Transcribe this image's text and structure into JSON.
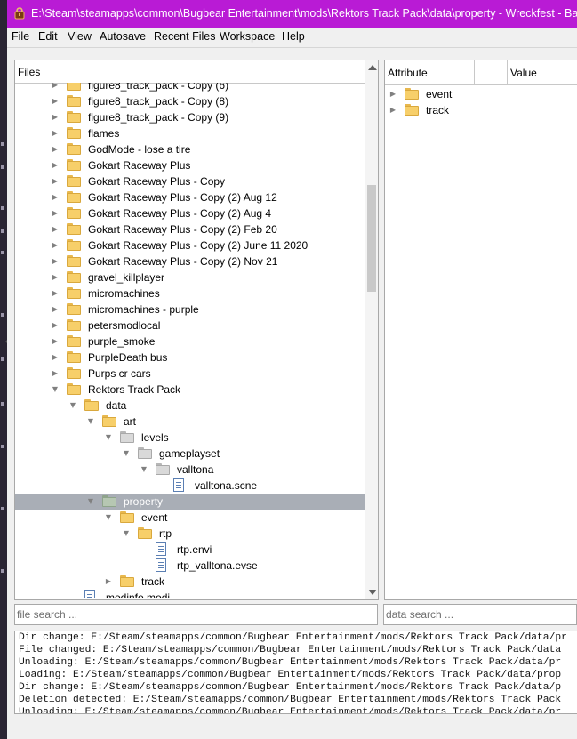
{
  "window": {
    "title": "E:\\Steam\\steamapps\\common\\Bugbear Entertainment\\mods\\Rektors Track Pack\\data\\property - Wreckfest - Bag Ed"
  },
  "menu": [
    "File",
    "Edit",
    "View",
    "Autosave",
    "Recent Files",
    "Workspace",
    "Help"
  ],
  "files_panel": {
    "header": "Files",
    "rows": [
      {
        "label": "figure8_track_pack - Copy (6)",
        "depth": 1,
        "type": "folder",
        "expander": "collapsed",
        "color": "yellow"
      },
      {
        "label": "figure8_track_pack - Copy (8)",
        "depth": 1,
        "type": "folder",
        "expander": "collapsed",
        "color": "yellow"
      },
      {
        "label": "figure8_track_pack - Copy (9)",
        "depth": 1,
        "type": "folder",
        "expander": "collapsed",
        "color": "yellow"
      },
      {
        "label": "flames",
        "depth": 1,
        "type": "folder",
        "expander": "collapsed",
        "color": "yellow"
      },
      {
        "label": "GodMode - lose a tire",
        "depth": 1,
        "type": "folder",
        "expander": "collapsed",
        "color": "yellow"
      },
      {
        "label": "Gokart Raceway Plus",
        "depth": 1,
        "type": "folder",
        "expander": "collapsed",
        "color": "yellow"
      },
      {
        "label": "Gokart Raceway Plus - Copy",
        "depth": 1,
        "type": "folder",
        "expander": "collapsed",
        "color": "yellow"
      },
      {
        "label": "Gokart Raceway Plus - Copy (2) Aug 12",
        "depth": 1,
        "type": "folder",
        "expander": "collapsed",
        "color": "yellow"
      },
      {
        "label": "Gokart Raceway Plus - Copy (2) Aug 4",
        "depth": 1,
        "type": "folder",
        "expander": "collapsed",
        "color": "yellow"
      },
      {
        "label": "Gokart Raceway Plus - Copy (2) Feb 20",
        "depth": 1,
        "type": "folder",
        "expander": "collapsed",
        "color": "yellow"
      },
      {
        "label": "Gokart Raceway Plus - Copy (2) June 11 2020",
        "depth": 1,
        "type": "folder",
        "expander": "collapsed",
        "color": "yellow"
      },
      {
        "label": "Gokart Raceway Plus - Copy (2) Nov 21",
        "depth": 1,
        "type": "folder",
        "expander": "collapsed",
        "color": "yellow"
      },
      {
        "label": "gravel_killplayer",
        "depth": 1,
        "type": "folder",
        "expander": "collapsed",
        "color": "yellow"
      },
      {
        "label": "micromachines",
        "depth": 1,
        "type": "folder",
        "expander": "collapsed",
        "color": "yellow"
      },
      {
        "label": "micromachines - purple",
        "depth": 1,
        "type": "folder",
        "expander": "collapsed",
        "color": "yellow"
      },
      {
        "label": "petersmodlocal",
        "depth": 1,
        "type": "folder",
        "expander": "collapsed",
        "color": "yellow"
      },
      {
        "label": "purple_smoke",
        "depth": 1,
        "type": "folder",
        "expander": "collapsed",
        "color": "yellow"
      },
      {
        "label": "PurpleDeath bus",
        "depth": 1,
        "type": "folder",
        "expander": "collapsed",
        "color": "yellow"
      },
      {
        "label": "Purps cr cars",
        "depth": 1,
        "type": "folder",
        "expander": "collapsed",
        "color": "yellow"
      },
      {
        "label": "Rektors Track Pack",
        "depth": 1,
        "type": "folder",
        "expander": "expanded",
        "color": "yellow"
      },
      {
        "label": "data",
        "depth": 2,
        "type": "folder",
        "expander": "expanded",
        "color": "yellow"
      },
      {
        "label": "art",
        "depth": 3,
        "type": "folder",
        "expander": "expanded",
        "color": "yellow"
      },
      {
        "label": "levels",
        "depth": 4,
        "type": "folder",
        "expander": "expanded",
        "color": "gray"
      },
      {
        "label": "gameplayset",
        "depth": 5,
        "type": "folder",
        "expander": "expanded",
        "color": "gray"
      },
      {
        "label": "valltona",
        "depth": 6,
        "type": "folder",
        "expander": "expanded",
        "color": "gray"
      },
      {
        "label": "valltona.scne",
        "depth": 7,
        "type": "file",
        "expander": "none"
      },
      {
        "label": "property",
        "depth": 3,
        "type": "folder",
        "expander": "expanded",
        "color": "green",
        "selected": true
      },
      {
        "label": "event",
        "depth": 4,
        "type": "folder",
        "expander": "expanded",
        "color": "yellow"
      },
      {
        "label": "rtp",
        "depth": 5,
        "type": "folder",
        "expander": "expanded",
        "color": "yellow"
      },
      {
        "label": "rtp.envi",
        "depth": 6,
        "type": "file",
        "expander": "none"
      },
      {
        "label": "rtp_valltona.evse",
        "depth": 6,
        "type": "file",
        "expander": "none"
      },
      {
        "label": "track",
        "depth": 4,
        "type": "folder",
        "expander": "collapsed",
        "color": "yellow"
      },
      {
        "label": "modinfo.modi",
        "depth": 2,
        "type": "file",
        "expander": "none"
      }
    ]
  },
  "attributes_panel": {
    "columns": [
      "Attribute",
      "",
      "Value"
    ],
    "rows": [
      {
        "label": "event",
        "expander": "collapsed"
      },
      {
        "label": "track",
        "expander": "collapsed"
      }
    ]
  },
  "file_search": {
    "placeholder": "file search ..."
  },
  "data_search": {
    "placeholder": "data search ..."
  },
  "log": [
    "Dir change: E:/Steam/steamapps/common/Bugbear Entertainment/mods/Rektors Track Pack/data/pr",
    "File changed: E:/Steam/steamapps/common/Bugbear Entertainment/mods/Rektors Track Pack/data",
    "Unloading: E:/Steam/steamapps/common/Bugbear Entertainment/mods/Rektors Track Pack/data/pr",
    "Loading: E:/Steam/steamapps/common/Bugbear Entertainment/mods/Rektors Track Pack/data/prop",
    "Dir change: E:/Steam/steamapps/common/Bugbear Entertainment/mods/Rektors Track Pack/data/p",
    "Deletion detected: E:/Steam/steamapps/common/Bugbear Entertainment/mods/Rektors Track Pack",
    "Unloading: E:/Steam/steamapps/common/Bugbear Entertainment/mods/Rektors Track Pack/data/pr"
  ],
  "colors": {
    "titlebar": "#b91bd5",
    "selection": "#a9aeb6",
    "folder_yellow": "#f7cf6a",
    "folder_gray": "#d9d9d9",
    "folder_green": "#b6c7b2",
    "file_icon": "#5b7fb3"
  }
}
